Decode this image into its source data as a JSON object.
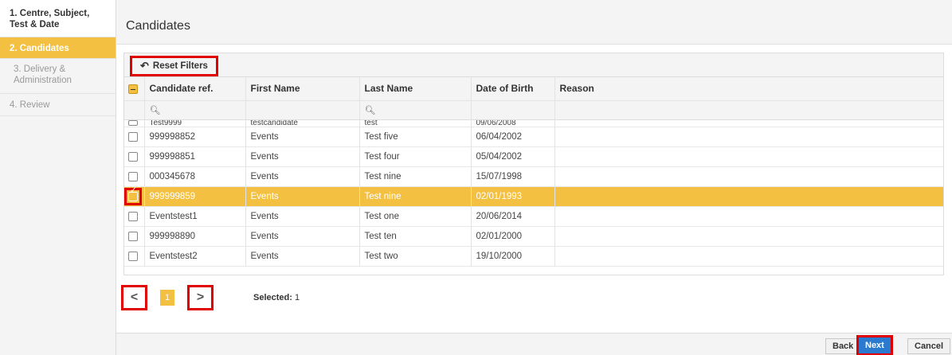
{
  "sidebar": {
    "steps": [
      {
        "label": "1. Centre, Subject, Test & Date",
        "state": "done"
      },
      {
        "label": "2. Candidates",
        "state": "active"
      },
      {
        "label": "3. Delivery & Administration",
        "state": "pending"
      },
      {
        "label": "4. Review",
        "state": "pending"
      }
    ]
  },
  "header": {
    "title": "Candidates"
  },
  "toolbar": {
    "reset_label": "Reset Filters",
    "reset_icon": "undo-icon"
  },
  "table": {
    "columns": [
      "Candidate ref.",
      "First Name",
      "Last Name",
      "Date of Birth",
      "Reason"
    ],
    "filter_icon": "search-icon",
    "partial_row": {
      "ref": "Test9999",
      "first": "testcandidate",
      "last": "test",
      "dob": "09/06/2008",
      "reason": ""
    },
    "rows": [
      {
        "ref": "999998852",
        "first": "Events",
        "last": "Test five",
        "dob": "06/04/2002",
        "reason": "",
        "checked": false
      },
      {
        "ref": "999998851",
        "first": "Events",
        "last": "Test four",
        "dob": "05/04/2002",
        "reason": "",
        "checked": false
      },
      {
        "ref": "000345678",
        "first": "Events",
        "last": "Test nine",
        "dob": "15/07/1998",
        "reason": "",
        "checked": false
      },
      {
        "ref": "999999859",
        "first": "Events",
        "last": "Test nine",
        "dob": "02/01/1993",
        "reason": "",
        "checked": true
      },
      {
        "ref": "Eventstest1",
        "first": "Events",
        "last": "Test one",
        "dob": "20/06/2014",
        "reason": "",
        "checked": false
      },
      {
        "ref": "999998890",
        "first": "Events",
        "last": "Test ten",
        "dob": "02/01/2000",
        "reason": "",
        "checked": false
      },
      {
        "ref": "Eventstest2",
        "first": "Events",
        "last": "Test two",
        "dob": "19/10/2000",
        "reason": "",
        "checked": false
      }
    ]
  },
  "pager": {
    "prev": "<",
    "next": ">",
    "page": "1",
    "selected_label": "Selected:",
    "selected_count": "1"
  },
  "footer": {
    "back": "Back",
    "next": "Next",
    "cancel": "Cancel"
  },
  "colors": {
    "accent": "#f3c042",
    "primary": "#2a7bd0",
    "highlight": "#e00000"
  }
}
